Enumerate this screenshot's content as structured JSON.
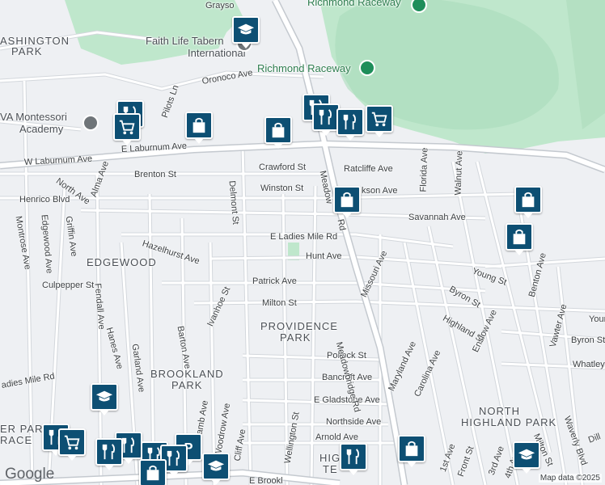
{
  "map": {
    "attribution": "Map data ©2025",
    "logo": "Google",
    "colors": {
      "background": "#eef0f3",
      "park": "#bfe7cc",
      "road": "#ffffff",
      "road_outline": "#c9ced4",
      "pin": "#0d4f73"
    }
  },
  "neighborhoods": [
    {
      "id": "washington-park",
      "line1": "ASHINGTON",
      "line2": "PARK"
    },
    {
      "id": "edgewood",
      "line1": "EDGEWOOD"
    },
    {
      "id": "providence-park",
      "line1": "PROVIDENCE",
      "line2": "PARK"
    },
    {
      "id": "brookland-park",
      "line1": "BROOKLAND",
      "line2": "PARK"
    },
    {
      "id": "north-highland-park",
      "line1": "NORTH",
      "line2": "HIGHLAND PARK"
    },
    {
      "id": "highland-terrace",
      "line1": "HIG",
      "line2": "TE"
    },
    {
      "id": "par-terrace",
      "line1": "ER PAR",
      "line2": "RACE"
    }
  ],
  "pois": {
    "faith_life": "Faith Life Tabernacle International",
    "faith_life_line1": "Faith Life Tabern",
    "faith_life_line2": "International",
    "richmond_raceway_top": "Richmond Raceway",
    "richmond_raceway": "Richmond Raceway",
    "montessori_line1": "VA Montessori",
    "montessori_line2": "Academy"
  },
  "streets": [
    "Grayso",
    "Oronoco Ave",
    "Pilots Ln",
    "Delmont St",
    "E Laburnum Ave",
    "W Laburnum Ave",
    "Brenton St",
    "Crawford St",
    "Ratcliffe Ave",
    "Winston St",
    "kson Ave",
    "Savannah Ave",
    "North Ave",
    "Alma Ave",
    "Henrico Blvd",
    "Montrose Ave",
    "Edgewood Ave",
    "Griffin Ave",
    "Hazelhurst Ave",
    "E Ladies Mile Rd",
    "Hunt Ave",
    "Patrick Ave",
    "Culpepper St",
    "Fendall Ave",
    "Hanes Ave",
    "Garland Ave",
    "Barton Ave",
    "Ivanhoe St",
    "Milton St",
    "Pollock St",
    "Bancroft Ave",
    "E Gladstone Ave",
    "Northside Ave",
    "Arnold Ave",
    "Meadowbridge Rd",
    "Meadow",
    "Rd",
    "Florida Ave",
    "Walnut Ave",
    "Missouri Ave",
    "Byron St",
    "Highland St",
    "Enslow Ave",
    "Maryland Ave",
    "Carolina Ave",
    "Young St",
    "Benton Ave",
    "Vawter Ave",
    "Byron St",
    "Whatley",
    "Your",
    "Waverly Blvd",
    "Milton St",
    "Dill",
    "adies Mile Rd",
    "Lamb Ave",
    "Woodrow Ave",
    "Cliff Ave",
    "Wellington St",
    "1st Ave",
    "Front St",
    "3rd Ave",
    "4th Ave",
    "E Brookl",
    "Edgewood Ave",
    "Patrick Ave",
    "Milton St",
    "Ave"
  ],
  "markers": [
    {
      "type": "school",
      "icon": "graduation-cap-icon"
    },
    {
      "type": "restaurant",
      "icon": "fork-knife-icon"
    },
    {
      "type": "grocery",
      "icon": "shopping-cart-icon"
    },
    {
      "type": "shopping",
      "icon": "shopping-bag-icon"
    },
    {
      "type": "parking",
      "icon": "parking-icon",
      "text": "P"
    }
  ]
}
